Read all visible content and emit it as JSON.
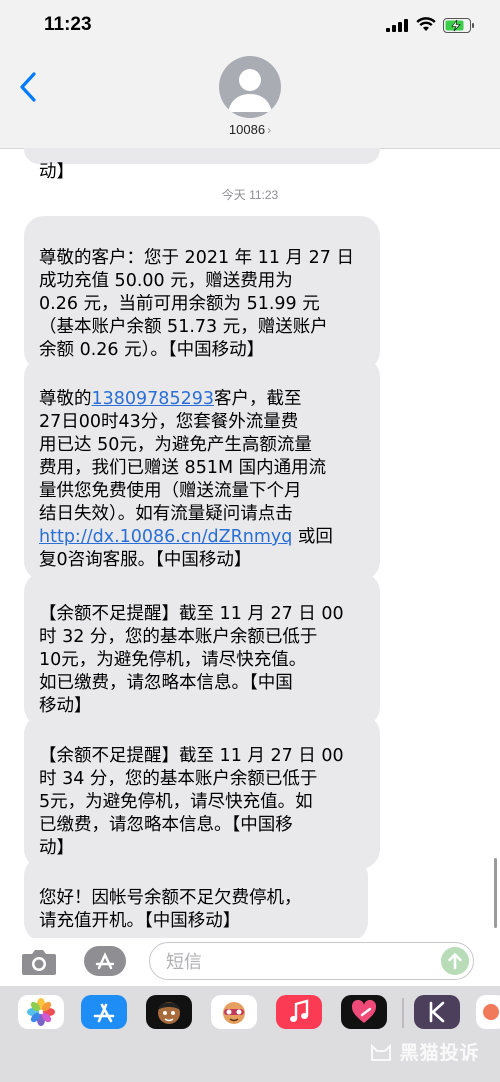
{
  "status_bar": {
    "time": "11:23"
  },
  "header": {
    "contact": "10086",
    "chevron": "›"
  },
  "thread": {
    "timestamp": "今天 11:23",
    "partial_top": "动】",
    "messages": [
      {
        "text": "尊敬的客户：您于 2021 年 11 月 27 日\n成功充值 50.00 元，赠送费用为\n0.26 元，当前可用余额为 51.99 元\n（基本账户余额 51.73 元，赠送账户\n余额 0.26 元）。【中国移动】"
      },
      {
        "prefix": "尊敬的",
        "phone": "13809785293",
        "middle": "客户，截至\n27日00时43分，您套餐外流量费\n用已达 50元，为避免产生高额流量\n费用，我们已赠送 851M 国内通用流\n量供您免费使用（赠送流量下个月\n结日失效）。如有流量疑问请点击\n",
        "link": "http://dx.10086.cn/dZRnmyq",
        "suffix": " 或回\n复0咨询客服。【中国移动】"
      },
      {
        "text": "【余额不足提醒】截至 11 月 27 日 00\n时 32 分，您的基本账户余额已低于\n10元，为避免停机，请尽快充值。\n如已缴费，请忽略本信息。【中国\n移动】"
      },
      {
        "text": "【余额不足提醒】截至 11 月 27 日 00\n时 34 分，您的基本账户余额已低于\n5元，为避免停机，请尽快充值。如\n已缴费，请忽略本信息。【中国移\n动】"
      },
      {
        "text": "您好！因帐号余额不足欠费停机，\n请充值开机。【中国移动】"
      }
    ]
  },
  "composer": {
    "placeholder": "短信"
  },
  "drawer": {
    "apps": [
      "photos",
      "app-store",
      "memoji",
      "animoji",
      "music",
      "heart",
      "k-app",
      "extra"
    ],
    "watermark": "黑猫投诉"
  },
  "colors": {
    "link": "#2a6fd6",
    "bubble": "#e9e9eb",
    "accent": "#007aff"
  }
}
